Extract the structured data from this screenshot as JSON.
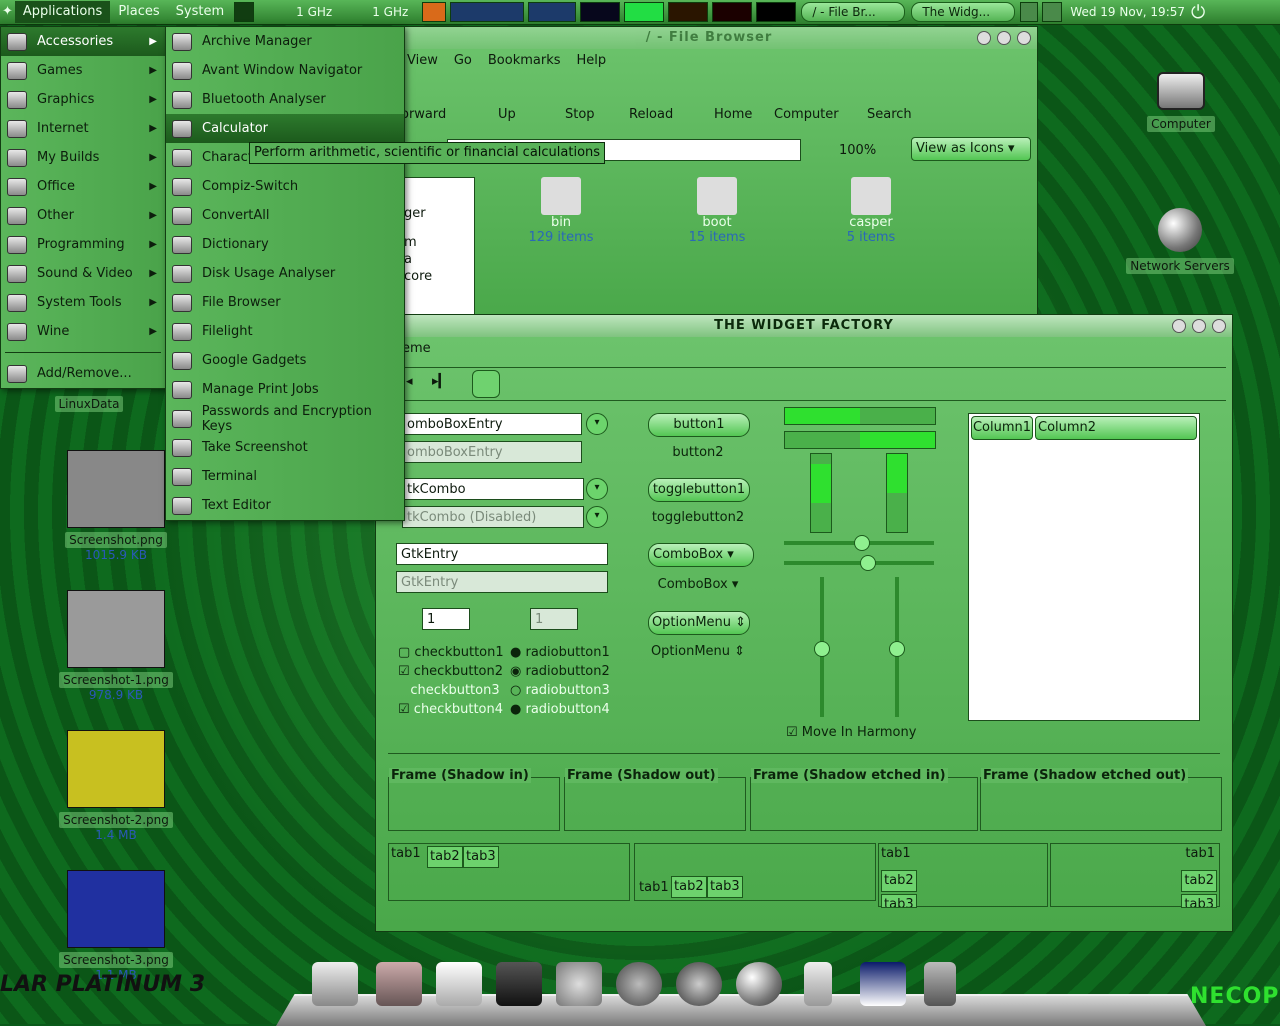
{
  "panel": {
    "menus": [
      "Applications",
      "Places",
      "System"
    ],
    "cpu": [
      "1 GHz",
      "1 GHz"
    ],
    "tasks": [
      "/ - File Br...",
      "The Widg..."
    ],
    "clock": "Wed 19 Nov, 19:57"
  },
  "apps_menu": {
    "items": [
      "Accessories",
      "Games",
      "Graphics",
      "Internet",
      "My Builds",
      "Office",
      "Other",
      "Programming",
      "Sound & Video",
      "System Tools",
      "Wine"
    ],
    "add_remove": "Add/Remove..."
  },
  "accessories_menu": {
    "items": [
      "Archive Manager",
      "Avant Window Navigator",
      "Bluetooth Analyser",
      "Calculator",
      "Charact",
      "Compiz-Switch",
      "ConvertAll",
      "Dictionary",
      "Disk Usage Analyser",
      "File Browser",
      "Filelight",
      "Google Gadgets",
      "Manage Print Jobs",
      "Passwords and Encryption Keys",
      "Take Screenshot",
      "Terminal",
      "Text Editor"
    ],
    "tooltip": "Perform arithmetic, scientific or financial calculations"
  },
  "desktop": {
    "linuxdata": "LinuxData",
    "computer": "Computer",
    "network": "Network Servers",
    "files": [
      {
        "name": "Screenshot.png",
        "size": "1015.9 KB",
        "color": "#888888"
      },
      {
        "name": "Screenshot-1.png",
        "size": "978.9 KB",
        "color": "#9a9a9a"
      },
      {
        "name": "Screenshot-2.png",
        "size": "1.4 MB",
        "color": "#c8c020"
      },
      {
        "name": "Screenshot-3.png",
        "size": "1.1 MB",
        "color": "#2030a0"
      }
    ]
  },
  "file_browser": {
    "title": "/ - File Browser",
    "menu": [
      "View",
      "Go",
      "Bookmarks",
      "Help"
    ],
    "toolbar": [
      "orward",
      "Up",
      "Stop",
      "Reload",
      "Home",
      "Computer",
      "Search"
    ],
    "zoom": "100%",
    "view_mode": "View as Icons",
    "side_items": [
      "ger",
      "m",
      "a",
      "core"
    ],
    "folders": [
      {
        "name": "bin",
        "count": "129 items"
      },
      {
        "name": "boot",
        "count": "15 items"
      },
      {
        "name": "casper",
        "count": "5 items"
      }
    ]
  },
  "widget_factory": {
    "title": "THE WIDGET FACTORY",
    "menu_fragment": "eme",
    "combo_entry": "omboBoxEntry",
    "combo_entry_dis": "omboBoxEntry",
    "gtkcombo": "tkCombo",
    "gtkcombo_dis": "tkCombo (Disabled)",
    "gtkentry": "GtkEntry",
    "gtkentry_dis": "GtkEntry",
    "spin1": "1",
    "spin2": "1",
    "checks": [
      "checkbutton1",
      "checkbutton2",
      "checkbutton3",
      "checkbutton4"
    ],
    "radios": [
      "radiobutton1",
      "radiobutton2",
      "radiobutton3",
      "radiobutton4"
    ],
    "buttons": [
      "button1",
      "button2",
      "togglebutton1",
      "togglebutton2",
      "ComboBox",
      "ComboBox",
      "OptionMenu",
      "OptionMenu"
    ],
    "harmony": "Move In Harmony",
    "columns": [
      "Column1",
      "Column2"
    ],
    "frames": [
      "Frame (Shadow in)",
      "Frame (Shadow out)",
      "Frame (Shadow etched in)",
      "Frame (Shadow etched out)"
    ],
    "tabs": [
      "tab1",
      "tab2",
      "tab3"
    ]
  },
  "brand": {
    "left": "LAR PLATINUM 3",
    "right": "NECOPI"
  }
}
